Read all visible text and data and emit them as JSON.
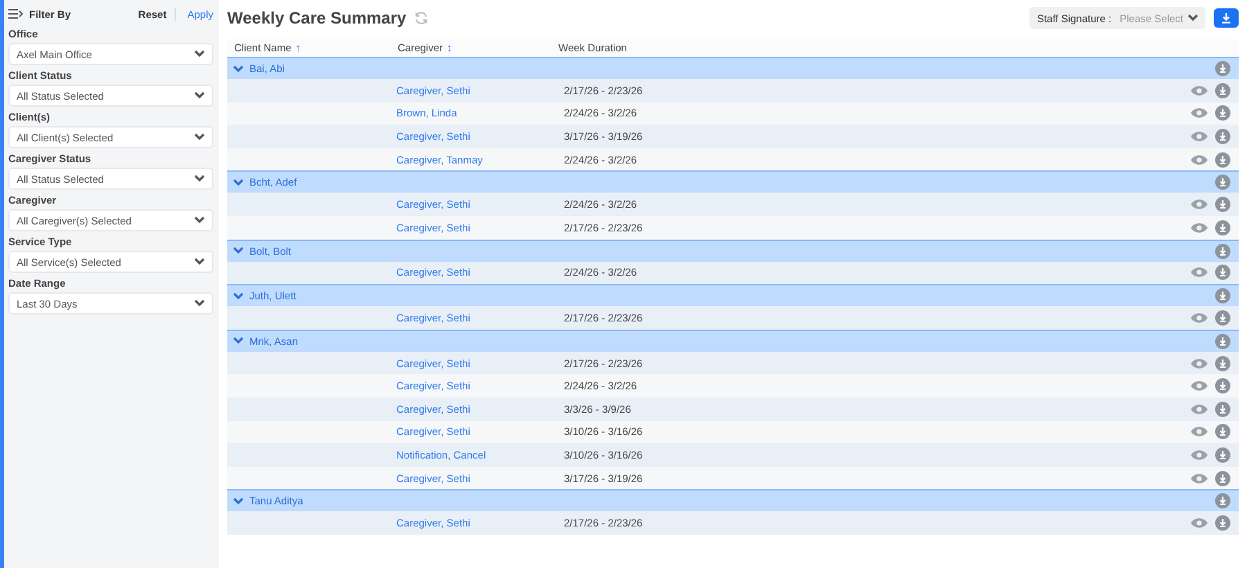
{
  "sidebar": {
    "title": "Filter By",
    "reset": "Reset",
    "apply": "Apply",
    "filters": [
      {
        "label": "Office",
        "value": "Axel Main Office"
      },
      {
        "label": "Client Status",
        "value": "All Status Selected"
      },
      {
        "label": "Client(s)",
        "value": "All Client(s) Selected"
      },
      {
        "label": "Caregiver Status",
        "value": "All Status Selected"
      },
      {
        "label": "Caregiver",
        "value": "All Caregiver(s) Selected"
      },
      {
        "label": "Service Type",
        "value": "All Service(s) Selected"
      },
      {
        "label": "Date Range",
        "value": "Last 30 Days"
      }
    ]
  },
  "header": {
    "title": "Weekly Care Summary",
    "staff_signature": {
      "label": "Staff Signature :",
      "placeholder": "Please Select"
    }
  },
  "table": {
    "columns": [
      {
        "label": "Client Name",
        "sort": "↑"
      },
      {
        "label": "Caregiver",
        "sort": "↕"
      },
      {
        "label": "Week Duration"
      }
    ],
    "groups": [
      {
        "client": "Bai, Abi",
        "expanded": true,
        "rows": [
          {
            "caregiver": "Caregiver, Sethi",
            "week": "2/17/26 - 2/23/26"
          },
          {
            "caregiver": "Brown, Linda",
            "week": "2/24/26 - 3/2/26"
          },
          {
            "caregiver": "Caregiver, Sethi",
            "week": "3/17/26 - 3/19/26"
          },
          {
            "caregiver": "Caregiver, Tanmay",
            "week": "2/24/26 - 3/2/26"
          }
        ]
      },
      {
        "client": "Bcht, Adef",
        "expanded": true,
        "rows": [
          {
            "caregiver": "Caregiver, Sethi",
            "week": "2/24/26 - 3/2/26"
          },
          {
            "caregiver": "Caregiver, Sethi",
            "week": "2/17/26 - 2/23/26"
          }
        ]
      },
      {
        "client": "Bolt, Bolt",
        "expanded": true,
        "rows": [
          {
            "caregiver": "Caregiver, Sethi",
            "week": "2/24/26 - 3/2/26"
          }
        ]
      },
      {
        "client": "Juth, Ulett",
        "expanded": true,
        "rows": [
          {
            "caregiver": "Caregiver, Sethi",
            "week": "2/17/26 - 2/23/26"
          }
        ]
      },
      {
        "client": "Mnk, Asan",
        "expanded": true,
        "rows": [
          {
            "caregiver": "Caregiver, Sethi",
            "week": "2/17/26 - 2/23/26"
          },
          {
            "caregiver": "Caregiver, Sethi",
            "week": "2/24/26 - 3/2/26"
          },
          {
            "caregiver": "Caregiver, Sethi",
            "week": "3/3/26 - 3/9/26"
          },
          {
            "caregiver": "Caregiver, Sethi",
            "week": "3/10/26 - 3/16/26"
          },
          {
            "caregiver": "Notification, Cancel",
            "week": "3/10/26 - 3/16/26"
          },
          {
            "caregiver": "Caregiver, Sethi",
            "week": "3/17/26 - 3/19/26"
          }
        ]
      },
      {
        "client": "Tanu Aditya",
        "expanded": true,
        "rows": [
          {
            "caregiver": "Caregiver, Sethi",
            "week": "2/17/26 - 2/23/26"
          }
        ]
      }
    ]
  }
}
